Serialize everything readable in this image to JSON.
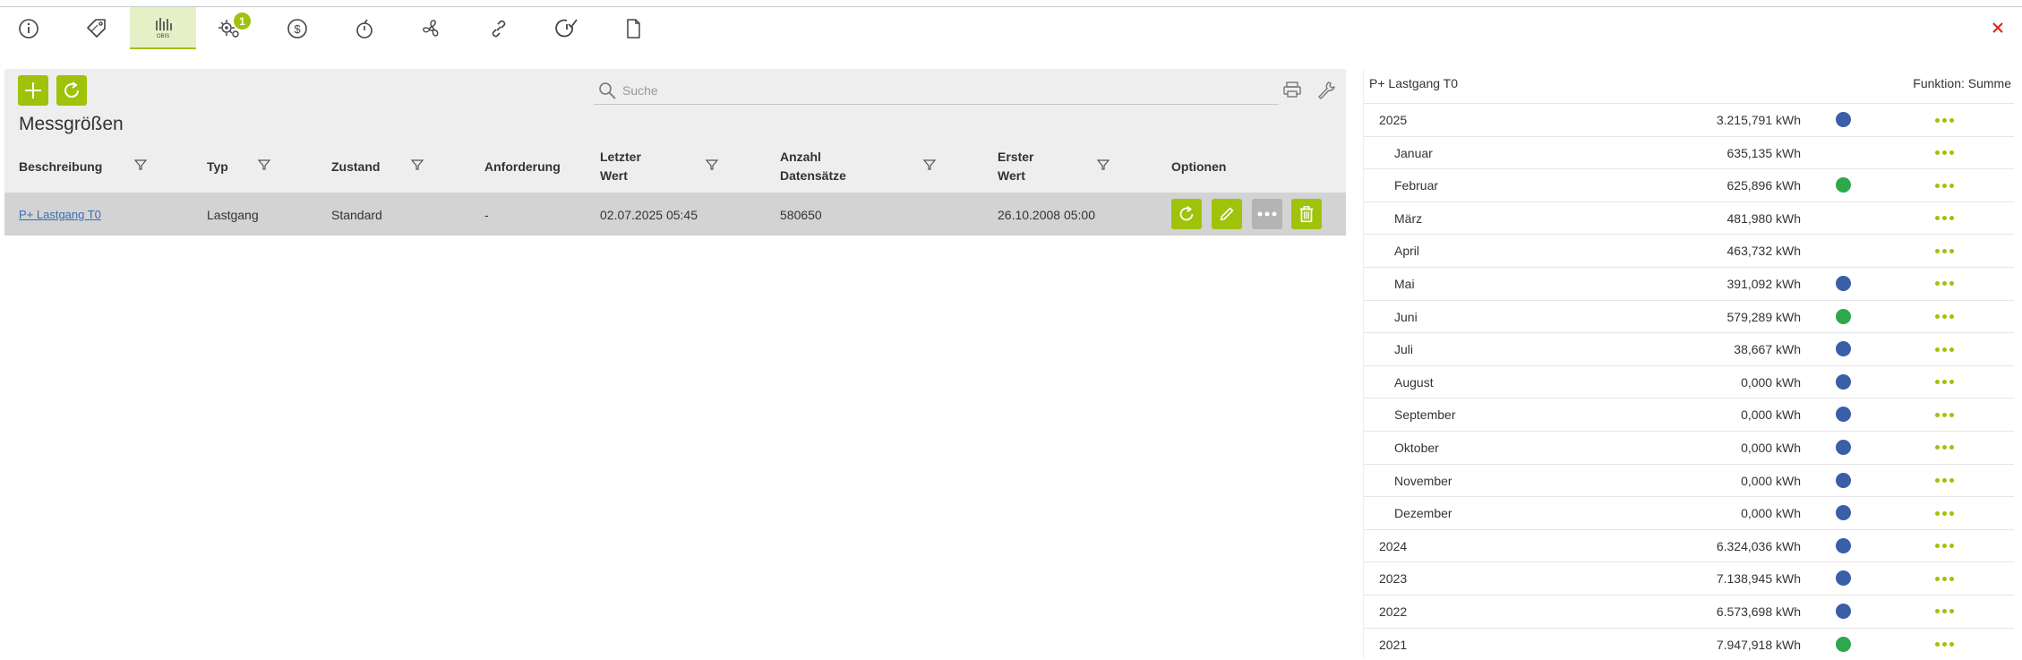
{
  "toolbar": {
    "tabs": [
      {
        "name": "info-icon",
        "active": false
      },
      {
        "name": "tag-icon",
        "active": false
      },
      {
        "name": "obis-icon",
        "active": true,
        "label": "OBIS"
      },
      {
        "name": "virus-gear-icon",
        "active": false,
        "badge": "1"
      },
      {
        "name": "dollar-icon",
        "active": false
      },
      {
        "name": "timer-icon",
        "active": false
      },
      {
        "name": "fan-icon",
        "active": false
      },
      {
        "name": "link-icon",
        "active": false
      },
      {
        "name": "clock-check-icon",
        "active": false
      },
      {
        "name": "document-icon",
        "active": false
      }
    ]
  },
  "colors": {
    "accent": "#9fc20a",
    "blue": "#3a5ea8",
    "green": "#2ea84a",
    "close": "#e02020"
  },
  "panel": {
    "title": "Messgrößen",
    "search_placeholder": "Suche",
    "columns": [
      "Beschreibung",
      "Typ",
      "Zustand",
      "Anforderung",
      "Letzter",
      "Wert",
      "Anzahl",
      "Datensätze",
      "Erster",
      "Wert",
      "Optionen"
    ],
    "row": {
      "beschreibung": "P+ Lastgang T0",
      "typ": "Lastgang",
      "zustand": "Standard",
      "anforderung": "-",
      "letzter_wert": "02.07.2025 05:45",
      "anzahl": "580650",
      "erster_wert": "26.10.2008 05:00"
    }
  },
  "right": {
    "title": "P+ Lastgang T0",
    "function": "Funktion: Summe",
    "rows": [
      {
        "label": "2025",
        "value": "3.215,791 kWh",
        "dot": "blue",
        "indent": false
      },
      {
        "label": "Januar",
        "value": "635,135 kWh",
        "dot": "",
        "indent": true
      },
      {
        "label": "Februar",
        "value": "625,896 kWh",
        "dot": "green",
        "indent": true
      },
      {
        "label": "März",
        "value": "481,980 kWh",
        "dot": "",
        "indent": true
      },
      {
        "label": "April",
        "value": "463,732 kWh",
        "dot": "",
        "indent": true
      },
      {
        "label": "Mai",
        "value": "391,092 kWh",
        "dot": "blue",
        "indent": true
      },
      {
        "label": "Juni",
        "value": "579,289 kWh",
        "dot": "green",
        "indent": true
      },
      {
        "label": "Juli",
        "value": "38,667 kWh",
        "dot": "blue",
        "indent": true
      },
      {
        "label": "August",
        "value": "0,000 kWh",
        "dot": "blue",
        "indent": true
      },
      {
        "label": "September",
        "value": "0,000 kWh",
        "dot": "blue",
        "indent": true
      },
      {
        "label": "Oktober",
        "value": "0,000 kWh",
        "dot": "blue",
        "indent": true
      },
      {
        "label": "November",
        "value": "0,000 kWh",
        "dot": "blue",
        "indent": true
      },
      {
        "label": "Dezember",
        "value": "0,000 kWh",
        "dot": "blue",
        "indent": true
      },
      {
        "label": "2024",
        "value": "6.324,036 kWh",
        "dot": "blue",
        "indent": false
      },
      {
        "label": "2023",
        "value": "7.138,945 kWh",
        "dot": "blue",
        "indent": false
      },
      {
        "label": "2022",
        "value": "6.573,698 kWh",
        "dot": "blue",
        "indent": false
      },
      {
        "label": "2021",
        "value": "7.947,918 kWh",
        "dot": "green",
        "indent": false
      }
    ]
  }
}
